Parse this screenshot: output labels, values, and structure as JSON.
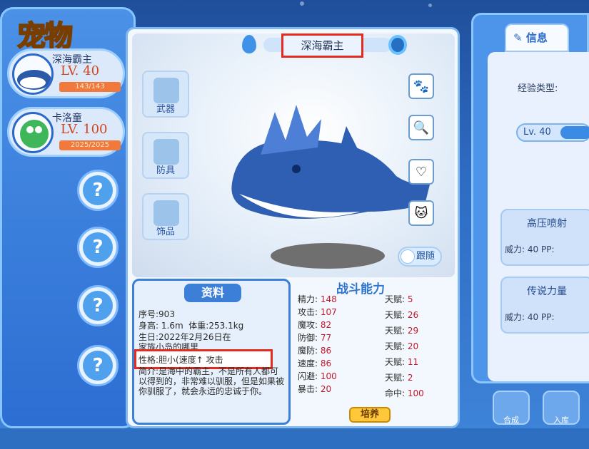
{
  "window": {
    "title": "宠物"
  },
  "pets": [
    {
      "name": "深海霸主",
      "level": "LV. 40",
      "hp": "143/143"
    },
    {
      "name": "卡洛童",
      "level": "LV. 100",
      "hp": "2025/2025"
    }
  ],
  "pet_view": {
    "name": "深海霸主",
    "equipment": [
      "武器",
      "防具",
      "饰品"
    ],
    "follow_label": "跟随"
  },
  "info_panel": {
    "header": "资料",
    "id_label": "序号:",
    "id_value": "903",
    "height_label": "身高:",
    "height_value": "1.6m",
    "weight_label": "体重:",
    "weight_value": "253.1kg",
    "birthday_label": "生日:",
    "birthday_value": "2022年2月26日在",
    "residence": "家族小岛的哪里",
    "nature_label": "性格:",
    "nature_value": "胆小(速度↑ 攻击",
    "desc_label": "简介:",
    "description": "是海中的霸主，不是所有人都可以得到的，非常难以驯服，但是如果被你驯服了，就会永远的忠诚于你。"
  },
  "stats": {
    "header": "战斗能力",
    "left": [
      {
        "label": "精力",
        "value": "148"
      },
      {
        "label": "攻击",
        "value": "107"
      },
      {
        "label": "魔攻",
        "value": "82"
      },
      {
        "label": "防御",
        "value": "77"
      },
      {
        "label": "魔防",
        "value": "86"
      },
      {
        "label": "速度",
        "value": "86"
      },
      {
        "label": "闪避",
        "value": "100"
      },
      {
        "label": "暴击",
        "value": "20"
      }
    ],
    "right": [
      {
        "label": "天赋",
        "value": "5"
      },
      {
        "label": "天赋",
        "value": "26"
      },
      {
        "label": "天赋",
        "value": "29"
      },
      {
        "label": "天赋",
        "value": "20"
      },
      {
        "label": "天赋",
        "value": "11"
      },
      {
        "label": "天赋",
        "value": "2"
      },
      {
        "label": "命中",
        "value": "100"
      }
    ],
    "train_button": "培养"
  },
  "right_panel": {
    "tab": "信息",
    "exp_label": "经验类型:",
    "level": "Lv. 40",
    "skills": [
      {
        "name": "高压喷射",
        "power": "威力: 40",
        "pp": "PP:"
      },
      {
        "name": "传说力量",
        "power": "威力: 40",
        "pp": "PP:"
      }
    ]
  },
  "bottom_buttons": [
    "合成",
    "入库"
  ]
}
